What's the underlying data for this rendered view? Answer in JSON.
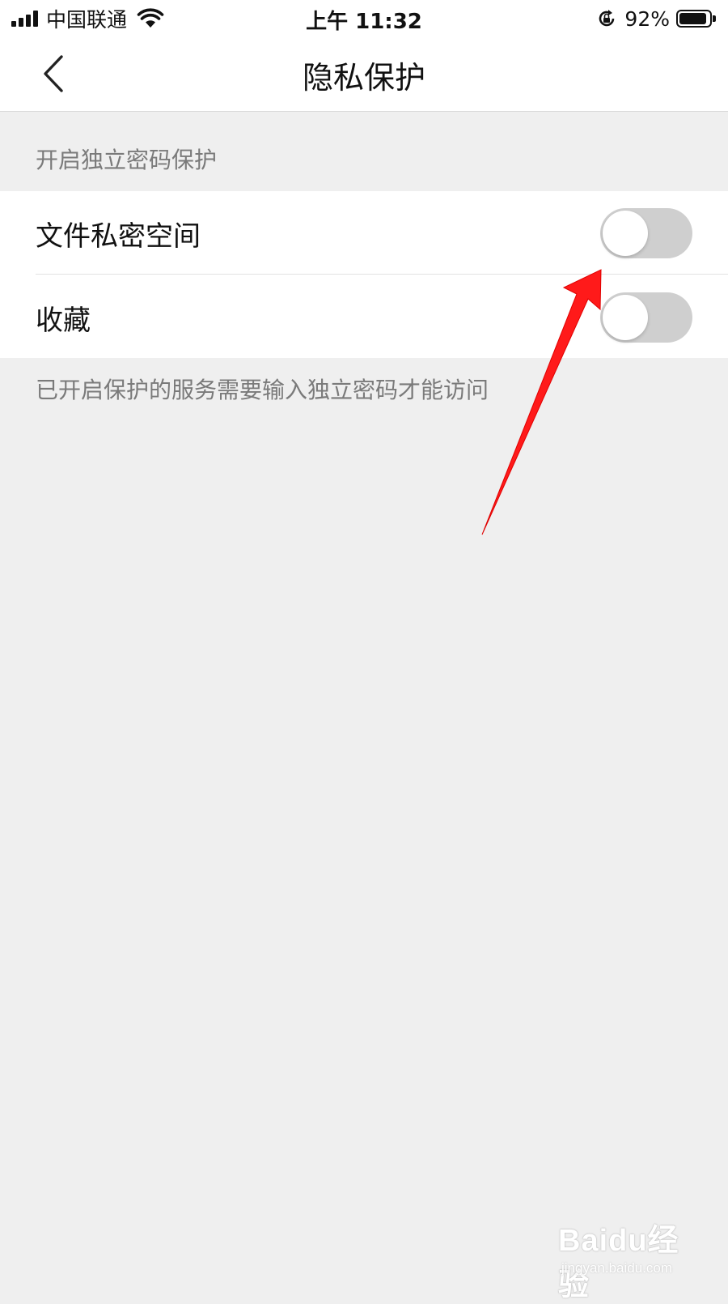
{
  "status_bar": {
    "carrier": "中国联通",
    "time": "上午 11:32",
    "battery_percent_text": "92%",
    "battery_level": 0.92
  },
  "nav": {
    "title": "隐私保护",
    "back_icon": "chevron-left-icon"
  },
  "section": {
    "header": "开启独立密码保护",
    "items": [
      {
        "label": "文件私密空间",
        "enabled": false
      },
      {
        "label": "收藏",
        "enabled": false
      }
    ],
    "footer": "已开启保护的服务需要输入独立密码才能访问"
  },
  "annotation": {
    "type": "arrow",
    "color": "#ff1a1a",
    "target": "文件私密空间 toggle"
  },
  "watermark": {
    "main": "Baidu经验",
    "sub": "jingyan.baidu.com"
  }
}
